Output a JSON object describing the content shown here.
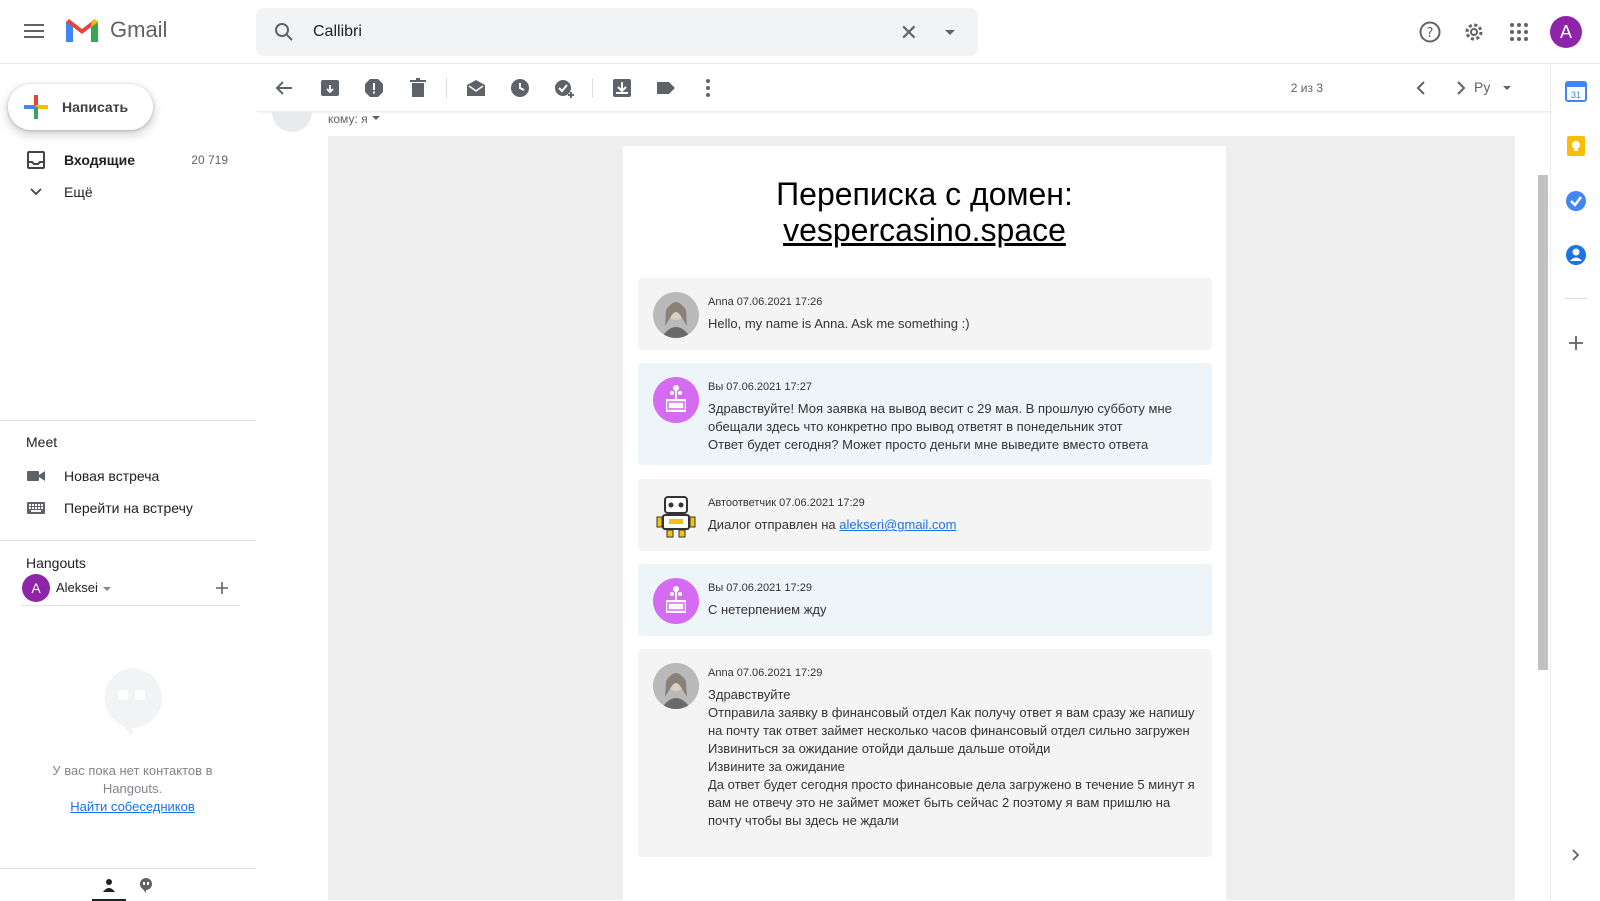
{
  "app": {
    "name": "Gmail"
  },
  "search": {
    "query": "Callibri"
  },
  "compose": {
    "label": "Написать"
  },
  "nav": {
    "inbox_label": "Входящие",
    "inbox_count": "20 719",
    "more_label": "Ещё"
  },
  "meet": {
    "title": "Meet",
    "new_meeting": "Новая встреча",
    "join_meeting": "Перейти на встречу"
  },
  "hangouts": {
    "title": "Hangouts",
    "user_initial": "A",
    "user_name": "Aleksei",
    "empty_text": "У вас пока нет контактов в Hangouts.",
    "find_link": "Найти собеседников"
  },
  "toolbar": {
    "pager": "2 из 3",
    "lang": "Ру"
  },
  "account": {
    "initial": "A"
  },
  "email": {
    "to_line": "кому: я",
    "title_line1": "Переписка с домен:",
    "title_domain": "vespercasino.space",
    "messages": [
      {
        "meta": "Anna 07.06.2021 17:26",
        "lines": [
          "Hello, my name is Anna. Ask me something :)"
        ]
      },
      {
        "meta": "Вы 07.06.2021 17:27",
        "lines": [
          "Здравствуйте! Моя заявка на вывод весит с 29 мая. В прошлую субботу мне обещали здесь что конкретно про вывод ответят в понедельник этот",
          "Ответ будет сегодня? Может просто деньги мне выведите вместо ответа"
        ]
      },
      {
        "meta": "Автоответчик 07.06.2021 17:29",
        "text": "Диалог отправлен на",
        "link": "alekseri@gmail.com"
      },
      {
        "meta": "Вы 07.06.2021 17:29",
        "lines": [
          "С нетерпением жду"
        ]
      },
      {
        "meta": "Anna 07.06.2021 17:29",
        "lines": [
          "Здравствуйте",
          "Отправила заявку в финансовый отдел Как получу ответ я вам сразу же напишу на почту так ответ займет несколько часов финансовый отдел сильно загружен",
          "Извиниться за ожидание отойди дальше дальше отойди",
          "Извините за ожидание",
          "Да ответ будет сегодня просто финансовые дела загружено в течение 5 минут я вам не отвечу это не займет может быть сейчас 2 поэтому я вам пришлю на почту чтобы вы здесь не ждали"
        ]
      }
    ]
  },
  "colors": {
    "anna_bg": "#f4f4f4",
    "you_bg": "#edf5f8",
    "you_avatar": "#d56bf0",
    "account_avatar": "#8e24aa"
  }
}
